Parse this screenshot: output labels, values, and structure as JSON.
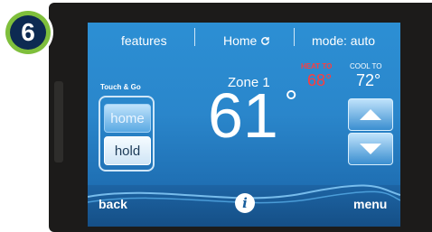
{
  "badge": {
    "number": "6",
    "fill_color": "#0d2a52",
    "ring_color": "#7fbf3c"
  },
  "header": {
    "features_label": "features",
    "home_label": "Home",
    "home_icon": "refresh-icon",
    "mode_label": "mode: auto"
  },
  "preset": {
    "title": "Touch & Go",
    "home_label": "home",
    "hold_label": "hold"
  },
  "zone": {
    "name": "Zone 1",
    "current_temp": "61",
    "degree_symbol": "°"
  },
  "setpoints": {
    "heat_label": "HEAT TO",
    "heat_value": "68°",
    "heat_color": "#ff3c3c",
    "cool_label": "COOL TO",
    "cool_value": "72°"
  },
  "controls": {
    "up_icon": "arrow-up-icon",
    "down_icon": "arrow-down-icon"
  },
  "footer": {
    "back_label": "back",
    "info_label": "i",
    "menu_label": "menu"
  }
}
